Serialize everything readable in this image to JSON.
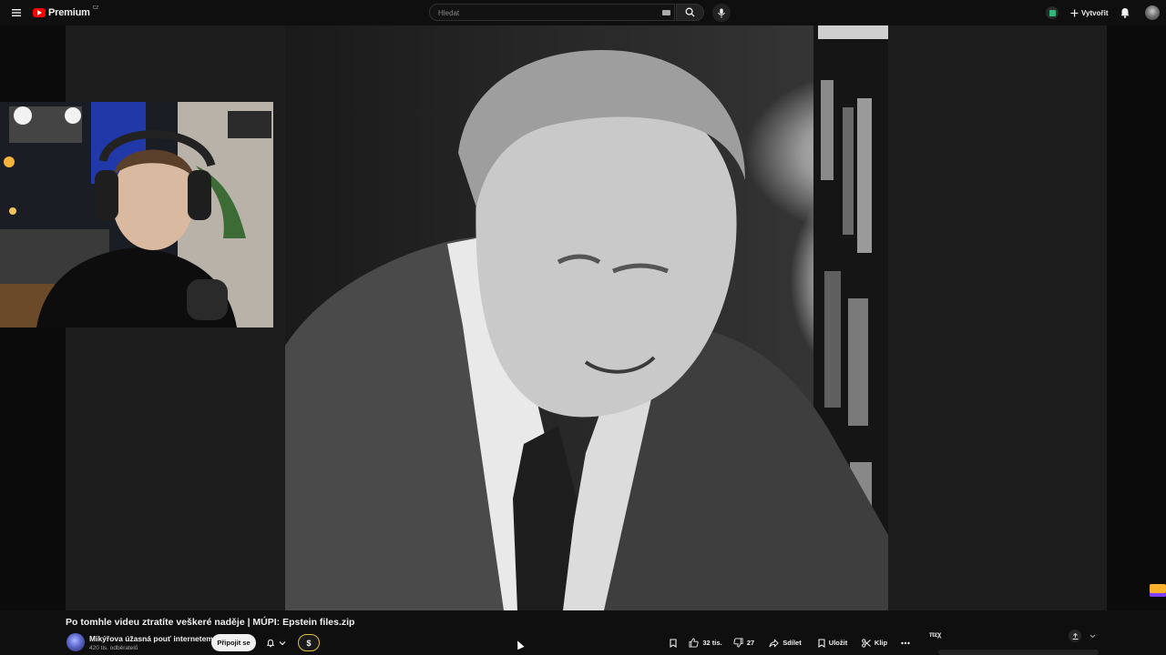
{
  "header": {
    "logo_text": "Premium",
    "logo_region": "CZ",
    "search_placeholder": "Hledat",
    "create_label": "Vytvořit"
  },
  "video": {
    "title": "Po tomhle videu ztratíte veškeré naděje | MÚPI: Epstein files.zip",
    "channel_name": "Mikýřova úžasná pouť internetem",
    "subscribers": "420 tis. odběratelů",
    "join_label": "Připojit se",
    "thanks_symbol": "$"
  },
  "actions": {
    "likes": "32 tis.",
    "dislikes": "27",
    "share_label": "Sdílet",
    "save_label": "Uložit",
    "clip_label": "Klip"
  },
  "right_panel": {
    "logo_text": "πεχ"
  },
  "colors": {
    "background": "#0f0f0f",
    "brand_red": "#ff0000",
    "thanks_outline": "#e8c230"
  }
}
